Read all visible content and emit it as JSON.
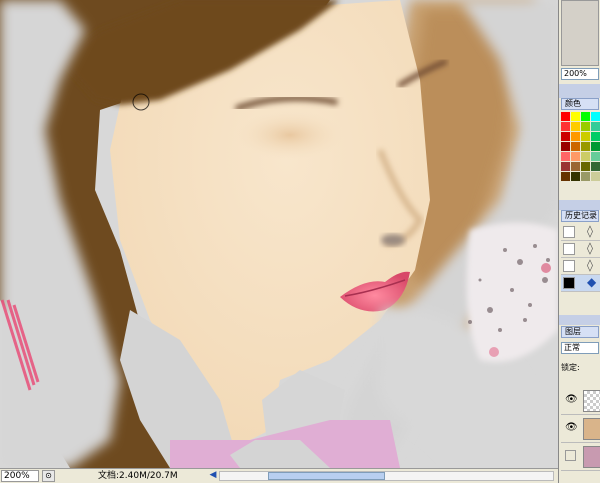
{
  "canvas": {
    "skin_color": "#f5e1c4",
    "hair_color": "#6e4a1f",
    "lip_color": "#e8607a",
    "bg_gray": "#d8d8d8"
  },
  "panels": {
    "navigator_zoom": "200%",
    "color_tab": "颜色",
    "swatches": [
      "#ff0000",
      "#ffff00",
      "#00ff00",
      "#00ffff",
      "#ff3333",
      "#ffcc00",
      "#99cc00",
      "#33cc99",
      "#cc0000",
      "#ff9900",
      "#cccc00",
      "#00cc66",
      "#990000",
      "#cc6600",
      "#999900",
      "#009933",
      "#ff6666",
      "#ff9966",
      "#cccc66",
      "#66cc99",
      "#993333",
      "#996633",
      "#666600",
      "#336633",
      "#663300",
      "#333300",
      "#999966",
      "#cccc99"
    ],
    "history_tab": "历史记录",
    "layers_tab": "图层",
    "blend_mode": "正常",
    "lock_label": "锁定:"
  },
  "status": {
    "zoom": "200%",
    "doc_info": "文档:2.40M/20.7M",
    "scroll_fraction": 0.35
  }
}
